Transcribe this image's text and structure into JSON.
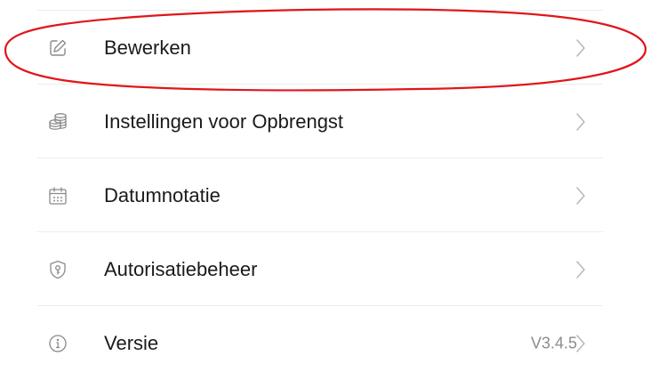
{
  "menu": {
    "items": [
      {
        "label": "Bewerken",
        "icon": "edit-icon",
        "value": ""
      },
      {
        "label": "Instellingen voor Opbrengst",
        "icon": "coins-stack-icon",
        "value": ""
      },
      {
        "label": "Datumnotatie",
        "icon": "calendar-icon",
        "value": ""
      },
      {
        "label": "Autorisatiebeheer",
        "icon": "shield-key-icon",
        "value": ""
      },
      {
        "label": "Versie",
        "icon": "info-icon",
        "value": "V3.4.5"
      }
    ]
  },
  "colors": {
    "icon_stroke": "#8a8a8a",
    "chevron": "#b5b5b5",
    "highlight": "#e0161b",
    "divider": "#ececec"
  }
}
